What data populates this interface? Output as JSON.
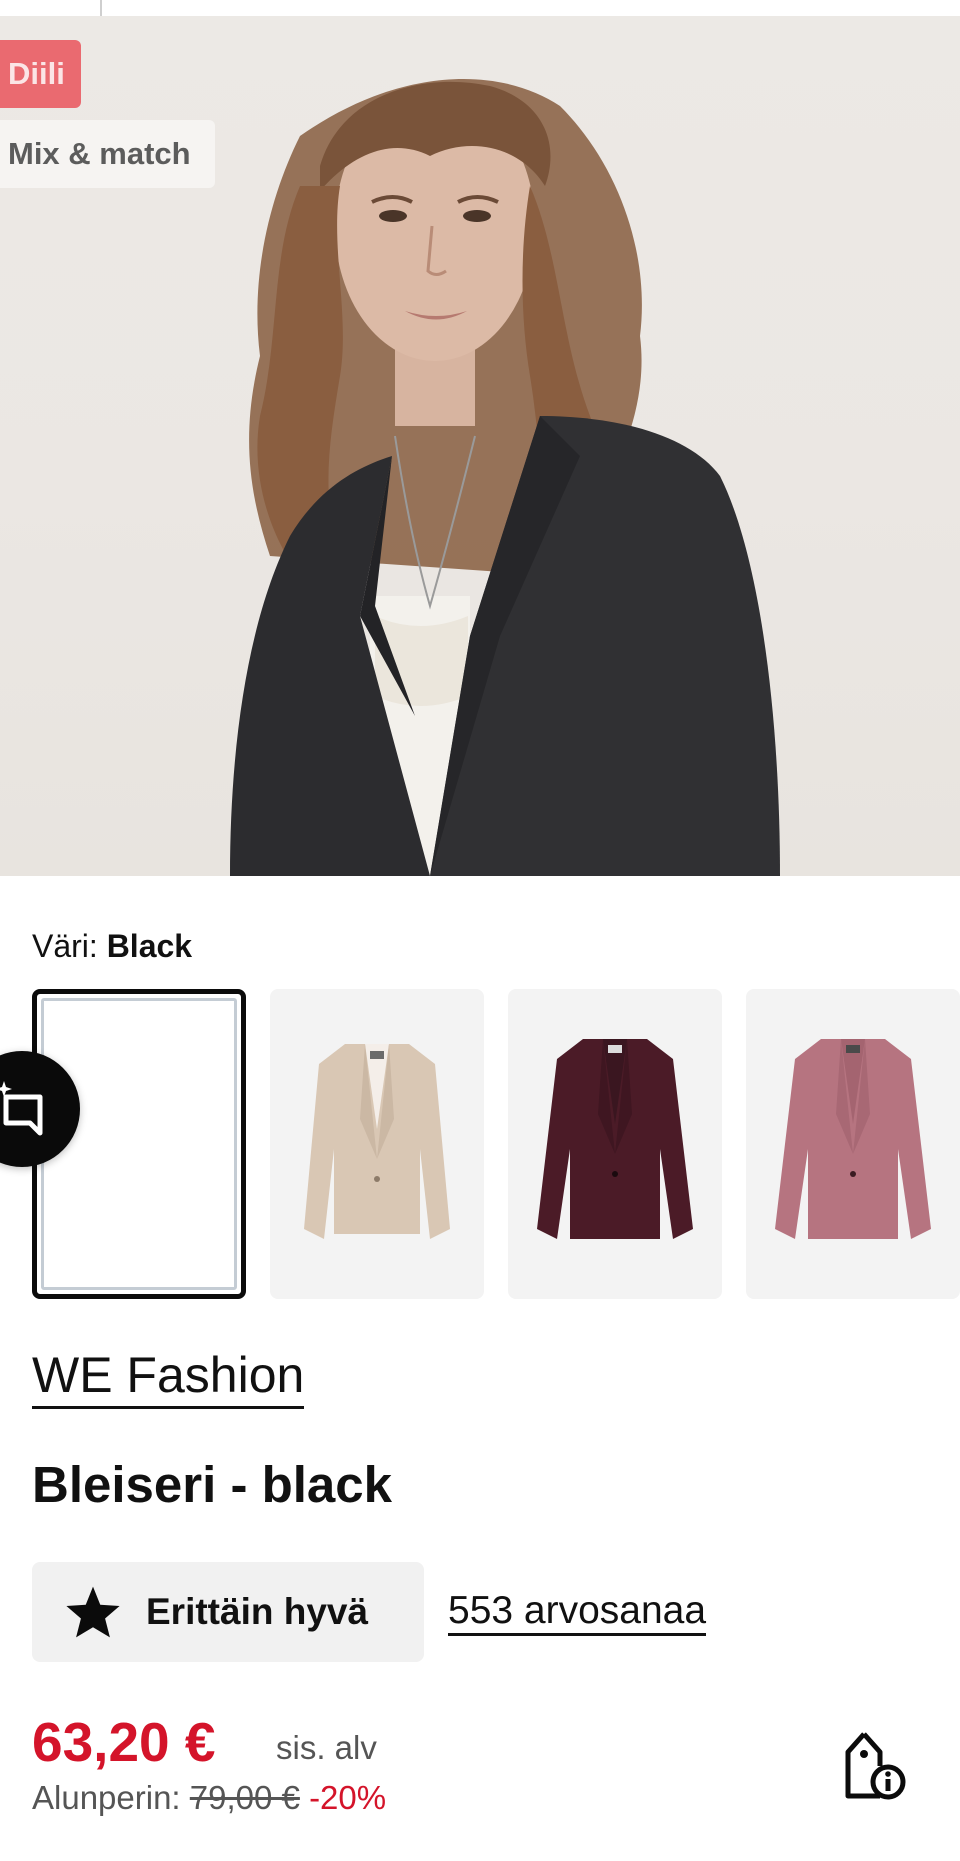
{
  "badges": {
    "deal": "Diili",
    "mix": "Mix & match"
  },
  "color_selector": {
    "label": "Väri:",
    "selected": "Black",
    "swatches": [
      {
        "name": "Black",
        "selected": true,
        "color": "#ffffff"
      },
      {
        "name": "Beige",
        "selected": false,
        "color": "#d8c6b5"
      },
      {
        "name": "Burgundy",
        "selected": false,
        "color": "#4a1a26"
      },
      {
        "name": "Dusty Rose",
        "selected": false,
        "color": "#b67480"
      }
    ]
  },
  "product": {
    "brand": "WE Fashion",
    "title": "Bleiseri - black"
  },
  "rating": {
    "label": "Erittäin hyvä",
    "reviews": "553 arvosanaa"
  },
  "price": {
    "current": "63,20 €",
    "vat_note": "sis. alv",
    "original_label": "Alunperin:",
    "original": "79,00 €",
    "discount": "-20%"
  },
  "colors": {
    "accent_red": "#d4142a",
    "deal_badge": "#ea6a70"
  },
  "icons": {
    "rating": "star-icon",
    "feedback": "feedback-icon",
    "price_info": "price-tag-info-icon"
  }
}
